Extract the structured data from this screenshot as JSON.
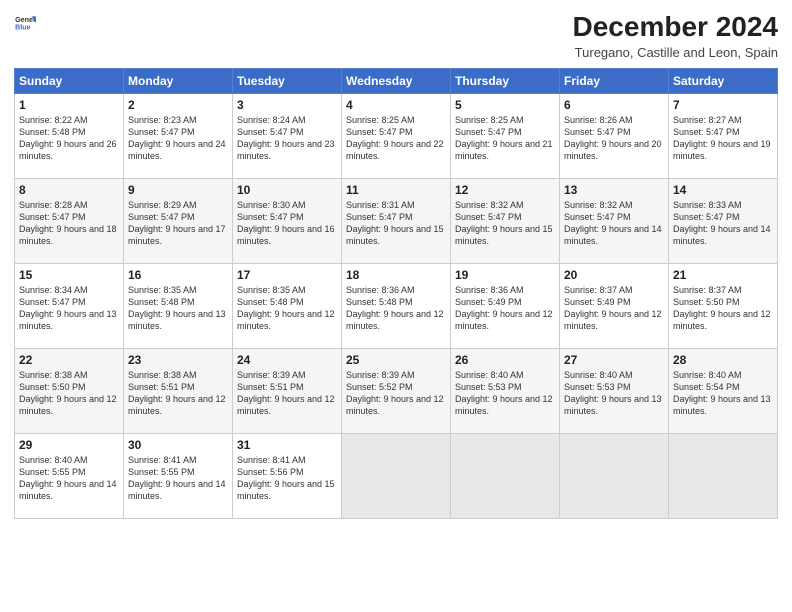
{
  "header": {
    "logo_general": "General",
    "logo_blue": "Blue",
    "title": "December 2024",
    "subtitle": "Turegano, Castille and Leon, Spain"
  },
  "weekdays": [
    "Sunday",
    "Monday",
    "Tuesday",
    "Wednesday",
    "Thursday",
    "Friday",
    "Saturday"
  ],
  "weeks": [
    [
      {
        "day": "1",
        "sunrise": "8:22 AM",
        "sunset": "5:48 PM",
        "daylight": "9 hours and 26 minutes."
      },
      {
        "day": "2",
        "sunrise": "8:23 AM",
        "sunset": "5:47 PM",
        "daylight": "9 hours and 24 minutes."
      },
      {
        "day": "3",
        "sunrise": "8:24 AM",
        "sunset": "5:47 PM",
        "daylight": "9 hours and 23 minutes."
      },
      {
        "day": "4",
        "sunrise": "8:25 AM",
        "sunset": "5:47 PM",
        "daylight": "9 hours and 22 minutes."
      },
      {
        "day": "5",
        "sunrise": "8:25 AM",
        "sunset": "5:47 PM",
        "daylight": "9 hours and 21 minutes."
      },
      {
        "day": "6",
        "sunrise": "8:26 AM",
        "sunset": "5:47 PM",
        "daylight": "9 hours and 20 minutes."
      },
      {
        "day": "7",
        "sunrise": "8:27 AM",
        "sunset": "5:47 PM",
        "daylight": "9 hours and 19 minutes."
      }
    ],
    [
      {
        "day": "8",
        "sunrise": "8:28 AM",
        "sunset": "5:47 PM",
        "daylight": "9 hours and 18 minutes."
      },
      {
        "day": "9",
        "sunrise": "8:29 AM",
        "sunset": "5:47 PM",
        "daylight": "9 hours and 17 minutes."
      },
      {
        "day": "10",
        "sunrise": "8:30 AM",
        "sunset": "5:47 PM",
        "daylight": "9 hours and 16 minutes."
      },
      {
        "day": "11",
        "sunrise": "8:31 AM",
        "sunset": "5:47 PM",
        "daylight": "9 hours and 15 minutes."
      },
      {
        "day": "12",
        "sunrise": "8:32 AM",
        "sunset": "5:47 PM",
        "daylight": "9 hours and 15 minutes."
      },
      {
        "day": "13",
        "sunrise": "8:32 AM",
        "sunset": "5:47 PM",
        "daylight": "9 hours and 14 minutes."
      },
      {
        "day": "14",
        "sunrise": "8:33 AM",
        "sunset": "5:47 PM",
        "daylight": "9 hours and 14 minutes."
      }
    ],
    [
      {
        "day": "15",
        "sunrise": "8:34 AM",
        "sunset": "5:47 PM",
        "daylight": "9 hours and 13 minutes."
      },
      {
        "day": "16",
        "sunrise": "8:35 AM",
        "sunset": "5:48 PM",
        "daylight": "9 hours and 13 minutes."
      },
      {
        "day": "17",
        "sunrise": "8:35 AM",
        "sunset": "5:48 PM",
        "daylight": "9 hours and 12 minutes."
      },
      {
        "day": "18",
        "sunrise": "8:36 AM",
        "sunset": "5:48 PM",
        "daylight": "9 hours and 12 minutes."
      },
      {
        "day": "19",
        "sunrise": "8:36 AM",
        "sunset": "5:49 PM",
        "daylight": "9 hours and 12 minutes."
      },
      {
        "day": "20",
        "sunrise": "8:37 AM",
        "sunset": "5:49 PM",
        "daylight": "9 hours and 12 minutes."
      },
      {
        "day": "21",
        "sunrise": "8:37 AM",
        "sunset": "5:50 PM",
        "daylight": "9 hours and 12 minutes."
      }
    ],
    [
      {
        "day": "22",
        "sunrise": "8:38 AM",
        "sunset": "5:50 PM",
        "daylight": "9 hours and 12 minutes."
      },
      {
        "day": "23",
        "sunrise": "8:38 AM",
        "sunset": "5:51 PM",
        "daylight": "9 hours and 12 minutes."
      },
      {
        "day": "24",
        "sunrise": "8:39 AM",
        "sunset": "5:51 PM",
        "daylight": "9 hours and 12 minutes."
      },
      {
        "day": "25",
        "sunrise": "8:39 AM",
        "sunset": "5:52 PM",
        "daylight": "9 hours and 12 minutes."
      },
      {
        "day": "26",
        "sunrise": "8:40 AM",
        "sunset": "5:53 PM",
        "daylight": "9 hours and 12 minutes."
      },
      {
        "day": "27",
        "sunrise": "8:40 AM",
        "sunset": "5:53 PM",
        "daylight": "9 hours and 13 minutes."
      },
      {
        "day": "28",
        "sunrise": "8:40 AM",
        "sunset": "5:54 PM",
        "daylight": "9 hours and 13 minutes."
      }
    ],
    [
      {
        "day": "29",
        "sunrise": "8:40 AM",
        "sunset": "5:55 PM",
        "daylight": "9 hours and 14 minutes."
      },
      {
        "day": "30",
        "sunrise": "8:41 AM",
        "sunset": "5:55 PM",
        "daylight": "9 hours and 14 minutes."
      },
      {
        "day": "31",
        "sunrise": "8:41 AM",
        "sunset": "5:56 PM",
        "daylight": "9 hours and 15 minutes."
      },
      null,
      null,
      null,
      null
    ]
  ],
  "labels": {
    "sunrise": "Sunrise:",
    "sunset": "Sunset:",
    "daylight": "Daylight:"
  }
}
